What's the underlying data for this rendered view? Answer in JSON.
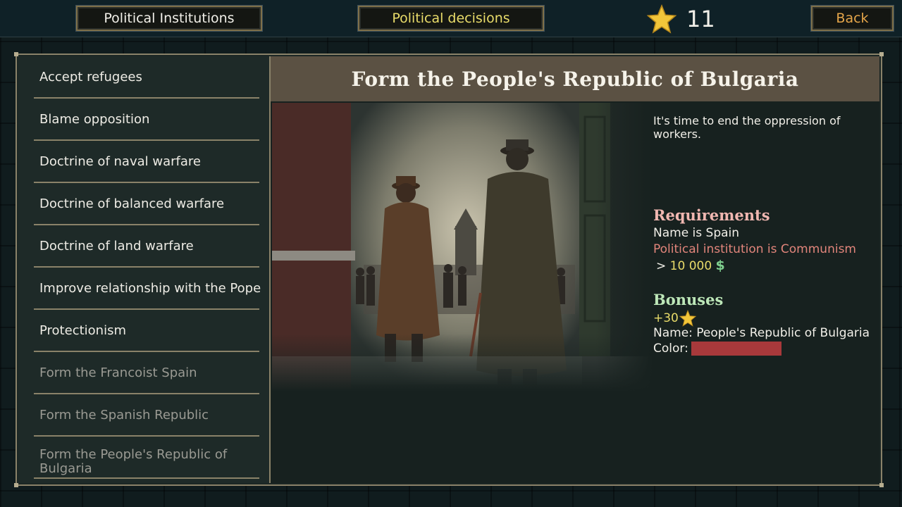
{
  "topbar": {
    "institutions_label": "Political Institutions",
    "decisions_label": "Political decisions",
    "star_count": "11",
    "back_label": "Back"
  },
  "decisions": [
    {
      "label": "Accept refugees",
      "available": true
    },
    {
      "label": "Blame opposition",
      "available": true
    },
    {
      "label": "Doctrine of naval warfare",
      "available": true
    },
    {
      "label": "Doctrine of balanced warfare",
      "available": true
    },
    {
      "label": "Doctrine of land warfare",
      "available": true
    },
    {
      "label": "Improve relationship with the Pope",
      "available": true
    },
    {
      "label": "Protectionism",
      "available": true
    },
    {
      "label": "Form the Francoist Spain",
      "available": false
    },
    {
      "label": "Form the Spanish Republic",
      "available": false
    },
    {
      "label": "Form the People's Republic of Bulgaria",
      "available": false
    }
  ],
  "detail": {
    "title": "Form the People's Republic of Bulgaria",
    "description": "It's time to end the oppression of workers.",
    "requirements_heading": "Requirements",
    "requirements": {
      "name_line": "Name is Spain",
      "institution_line": "Political institution is Communism",
      "money_prefix": ">",
      "money_amount": "10 000",
      "money_symbol": "$"
    },
    "bonuses_heading": "Bonuses",
    "bonuses": {
      "stars": "+30",
      "name_line": "Name: People's Republic of Bulgaria",
      "color_label": "Color:",
      "color_value": "#a8393b"
    },
    "illustration_icon": "two-soldiers-in-greatcoats-illustration"
  },
  "colors": {
    "accent_gold": "#e9dc6a",
    "back_orange": "#e6a64a",
    "requirements_pink": "#f0b7b1",
    "unmet_requirement": "#e2857b",
    "bonuses_green": "#bde7b8",
    "frame": "#8a8269",
    "title_bar": "#5b5143"
  }
}
